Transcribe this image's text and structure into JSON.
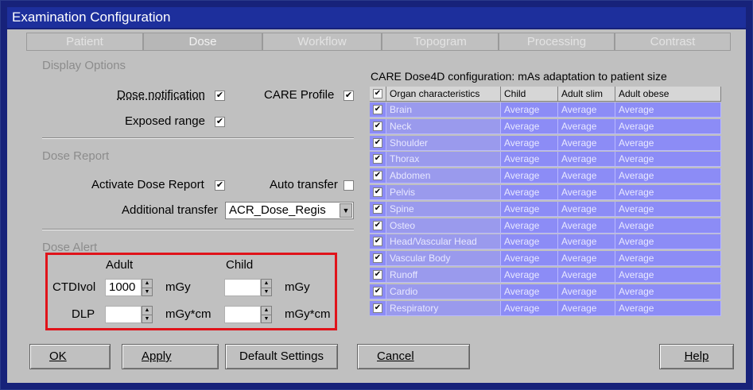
{
  "window": {
    "title": "Examination Configuration"
  },
  "tabs": [
    "Patient",
    "Dose",
    "Workflow",
    "Topogram",
    "Processing",
    "Contrast"
  ],
  "display_options": {
    "heading": "Display Options",
    "dose_notification": {
      "label": "Dose notification",
      "checked": "✔"
    },
    "care_profile": {
      "label": "CARE Profile",
      "checked": "✔"
    },
    "exposed_range": {
      "label": "Exposed range",
      "checked": "✔"
    }
  },
  "dose_report": {
    "heading": "Dose Report",
    "activate": {
      "label": "Activate Dose Report",
      "checked": "✔"
    },
    "auto_transfer": {
      "label": "Auto transfer",
      "checked": ""
    },
    "additional_transfer": {
      "label": "Additional transfer",
      "value": "ACR_Dose_Regis"
    }
  },
  "dose_alert": {
    "heading": "Dose Alert",
    "col_adult": "Adult",
    "col_child": "Child",
    "ctdivol": {
      "label": "CTDIvol",
      "adult_value": "1000",
      "unit": "mGy"
    },
    "dlp": {
      "label": "DLP",
      "unit": "mGy*cm"
    }
  },
  "care_dose": {
    "title": "CARE Dose4D configuration: mAs adaptation to patient size",
    "header_checked": "✔",
    "columns": [
      "Organ characteristics",
      "Child",
      "Adult slim",
      "Adult obese"
    ],
    "rows": [
      {
        "organ": "Brain",
        "child": "Average",
        "slim": "Average",
        "obese": "Average"
      },
      {
        "organ": "Neck",
        "child": "Average",
        "slim": "Average",
        "obese": "Average"
      },
      {
        "organ": "Shoulder",
        "child": "Average",
        "slim": "Average",
        "obese": "Average"
      },
      {
        "organ": "Thorax",
        "child": "Average",
        "slim": "Average",
        "obese": "Average"
      },
      {
        "organ": "Abdomen",
        "child": "Average",
        "slim": "Average",
        "obese": "Average"
      },
      {
        "organ": "Pelvis",
        "child": "Average",
        "slim": "Average",
        "obese": "Average"
      },
      {
        "organ": "Spine",
        "child": "Average",
        "slim": "Average",
        "obese": "Average"
      },
      {
        "organ": "Osteo",
        "child": "Average",
        "slim": "Average",
        "obese": "Average"
      },
      {
        "organ": "Head/Vascular Head",
        "child": "Average",
        "slim": "Average",
        "obese": "Average"
      },
      {
        "organ": "Vascular Body",
        "child": "Average",
        "slim": "Average",
        "obese": "Average"
      },
      {
        "organ": "Runoff",
        "child": "Average",
        "slim": "Average",
        "obese": "Average"
      },
      {
        "organ": "Cardio",
        "child": "Average",
        "slim": "Average",
        "obese": "Average"
      },
      {
        "organ": "Respiratory",
        "child": "Average",
        "slim": "Average",
        "obese": "Average"
      }
    ]
  },
  "buttons": {
    "ok": "OK",
    "apply": "Apply",
    "defaults": "Default Settings",
    "cancel": "Cancel",
    "help": "Help"
  },
  "colors": {
    "title_bar": "#1d2f9c",
    "table_row": "#8c8cf6",
    "alert_highlight": "#e0131a"
  }
}
